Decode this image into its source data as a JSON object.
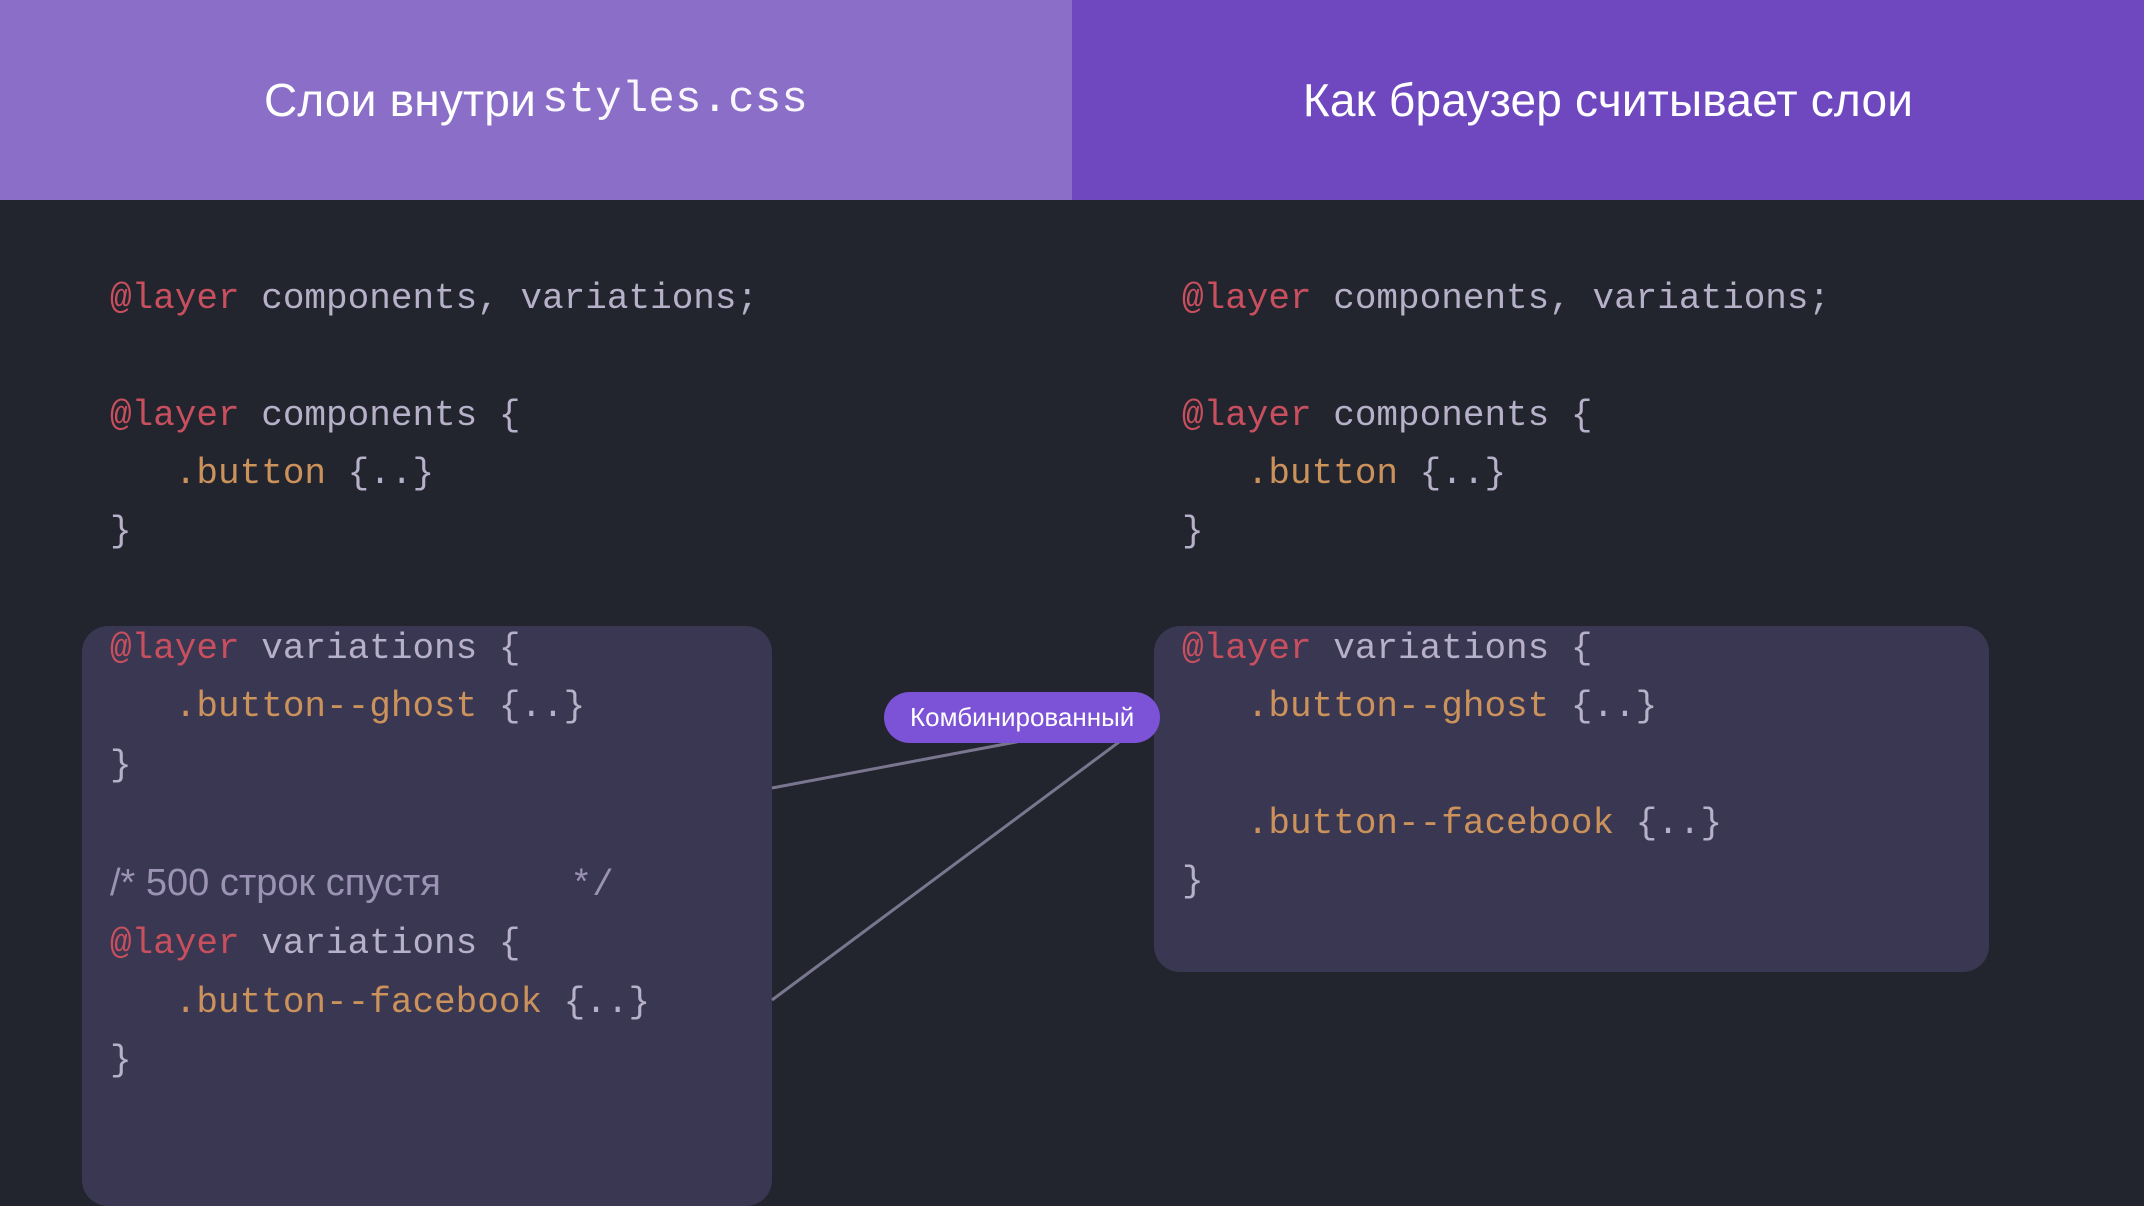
{
  "header": {
    "left_prefix": "Слои внутри",
    "left_mono": "styles.css",
    "right": "Как браузер считывает слои"
  },
  "left_code": {
    "l1_kw": "@layer",
    "l1_rest": " components, variations;",
    "l2_kw": "@layer",
    "l2_rest": " components {",
    "l3_sel": ".button",
    "l3_rest": " {..}",
    "l4": "}",
    "l5_kw": "@layer",
    "l5_rest": " variations {",
    "l6_sel": ".button--ghost",
    "l6_rest": " {..}",
    "l7": "}",
    "comment": "/* 500 строк спустя",
    "comment_end": "*/",
    "l8_kw": "@layer",
    "l8_rest": " variations {",
    "l9_sel": ".button--facebook",
    "l9_rest": " {..}",
    "l10": "}"
  },
  "right_code": {
    "l1_kw": "@layer",
    "l1_rest": " components, variations;",
    "l2_kw": "@layer",
    "l2_rest": " components {",
    "l3_sel": ".button",
    "l3_rest": " {..}",
    "l4": "}",
    "l5_kw": "@layer",
    "l5_rest": " variations {",
    "l6_sel": ".button--ghost",
    "l6_rest": " {..}",
    "l7_sel": ".button--facebook",
    "l7_rest": " {..}",
    "l8": "}"
  },
  "badge": "Комбинированный",
  "colors": {
    "header_left": "#8b6ec8",
    "header_right": "#6f48c0",
    "bg": "#22242e",
    "highlight": "#3a3752",
    "badge": "#7c52d6",
    "keyword": "#c74f5e",
    "selector": "#cb925b",
    "text": "#b6b0c8"
  }
}
